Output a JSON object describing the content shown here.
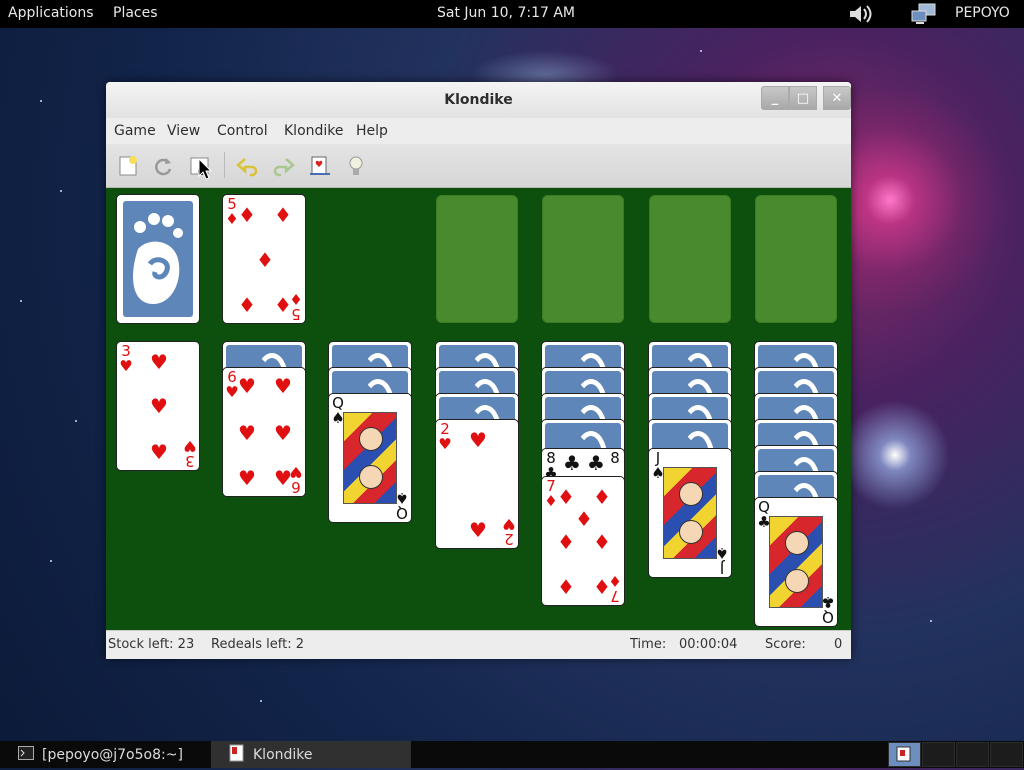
{
  "top_panel": {
    "applications": "Applications",
    "places": "Places",
    "clock": "Sat Jun 10,  7:17 AM",
    "user": "PEPOYO",
    "volume_icon": "speaker-icon",
    "network_icon": "network-icon"
  },
  "window": {
    "title": "Klondike",
    "controls": {
      "minimize": "_",
      "maximize": "□",
      "close": "✕"
    },
    "menu": [
      "Game",
      "View",
      "Control",
      "Klondike",
      "Help"
    ],
    "toolbar": [
      "new-game-icon",
      "restart-icon",
      "select-game-icon",
      "undo-icon",
      "redo-icon",
      "deal-icon",
      "hint-icon"
    ]
  },
  "board": {
    "waste_card": {
      "rank": "5",
      "suit": "♦"
    },
    "tableau": [
      {
        "face_down": 0,
        "face_up": [
          {
            "rank": "3",
            "suit": "♥"
          }
        ]
      },
      {
        "face_down": 1,
        "face_up": [
          {
            "rank": "6",
            "suit": "♥"
          }
        ]
      },
      {
        "face_down": 2,
        "face_up": [
          {
            "rank": "Q",
            "suit": "♠"
          }
        ]
      },
      {
        "face_down": 3,
        "face_up": [
          {
            "rank": "2",
            "suit": "♥"
          }
        ]
      },
      {
        "face_down": 4,
        "face_up": [
          {
            "rank": "8",
            "suit": "♣"
          },
          {
            "rank": "7",
            "suit": "♦"
          }
        ]
      },
      {
        "face_down": 4,
        "face_up": [
          {
            "rank": "J",
            "suit": "♠"
          }
        ]
      },
      {
        "face_down": 6,
        "face_up": [
          {
            "rank": "Q",
            "suit": "♣"
          }
        ]
      }
    ]
  },
  "status": {
    "stock": "Stock left: 23",
    "redeals": "Redeals left: 2",
    "time_label": "Time:",
    "time_value": "00:00:04",
    "score_label": "Score:",
    "score_value": "0"
  },
  "taskbar": {
    "terminal": "[pepoyo@j7o5o8:~]",
    "klondike": "Klondike"
  }
}
